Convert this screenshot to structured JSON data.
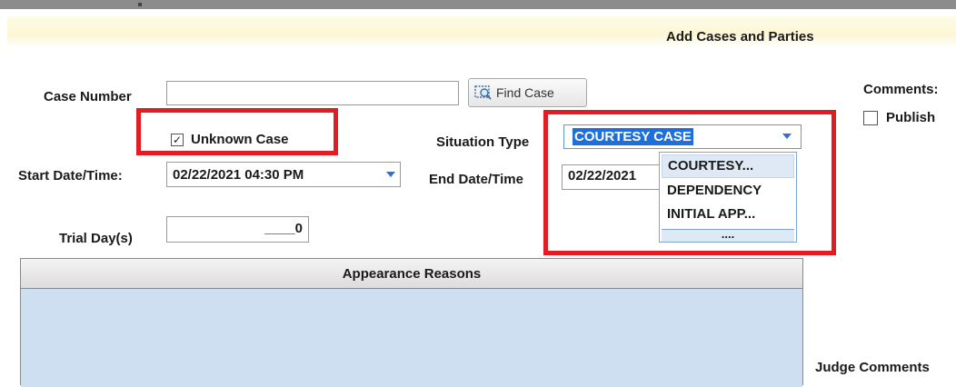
{
  "header": {
    "title": "Add Cases and Parties"
  },
  "case_number": {
    "label": "Case Number",
    "value": ""
  },
  "find_case_button": {
    "label": "Find Case",
    "icon": "search-icon"
  },
  "unknown_case": {
    "label": "Unknown Case",
    "checked": true
  },
  "situation_type": {
    "label": "Situation Type",
    "selected": "COURTESY CASE",
    "options": [
      "COURTESY...",
      "DEPENDENCY",
      "INITIAL APP...",
      "...."
    ]
  },
  "start_datetime": {
    "label": "Start Date/Time:",
    "value": "02/22/2021 04:30 PM"
  },
  "end_datetime": {
    "label": "End Date/Time",
    "value": "02/22/2021"
  },
  "trial_days": {
    "label": "Trial Day(s)",
    "value": "____0"
  },
  "comments": {
    "label": "Comments:",
    "publish_label": "Publish",
    "publish_checked": false
  },
  "appearance_reasons": {
    "header": "Appearance Reasons"
  },
  "judge_comments": {
    "label": "Judge Comments"
  },
  "colors": {
    "accent": "#1e6fd9",
    "highlight_border": "#e31b23",
    "panel_body": "#cfdff2"
  }
}
